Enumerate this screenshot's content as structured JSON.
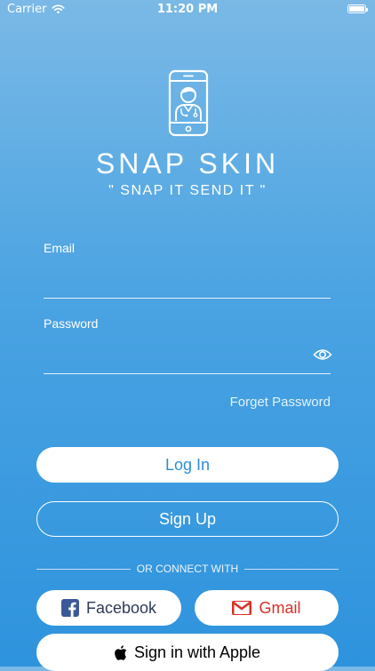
{
  "status_bar": {
    "carrier": "Carrier",
    "time": "11:20 PM",
    "battery_level": 1.0
  },
  "app": {
    "name": "SNAP SKIN",
    "tagline": "\" SNAP IT SEND IT \""
  },
  "form": {
    "email_label": "Email",
    "email_value": "",
    "password_label": "Password",
    "password_value": "",
    "forget_password": "Forget Password"
  },
  "actions": {
    "login": "Log In",
    "signup": "Sign Up"
  },
  "social": {
    "divider": "OR CONNECT WITH",
    "facebook": "Facebook",
    "gmail": "Gmail",
    "apple": "Sign in with Apple"
  },
  "icons": {
    "logo": "phone-doctor-icon",
    "wifi": "wifi-icon",
    "battery": "battery-icon",
    "password_toggle": "eye-icon",
    "facebook": "facebook-icon",
    "gmail": "gmail-icon",
    "apple": "apple-icon"
  },
  "colors": {
    "gradient_top": "#7ab9e6",
    "gradient_bottom": "#2e93dd",
    "login_text": "#2e8fd6",
    "facebook_blue": "#3b5998",
    "gmail_red": "#d93025"
  }
}
